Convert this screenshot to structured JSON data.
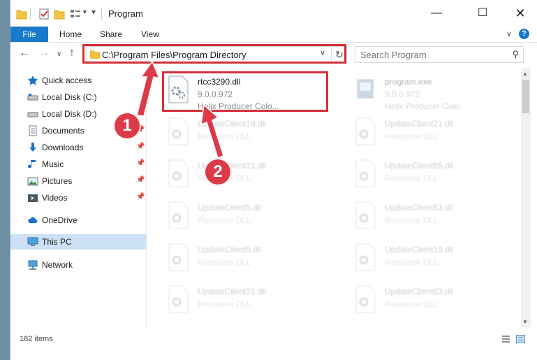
{
  "window": {
    "title": "Program"
  },
  "ribbon": {
    "file": "File",
    "home": "Home",
    "share": "Share",
    "view": "View",
    "help": "?"
  },
  "nav": {
    "address": "C:\\Program Files\\Program Directory",
    "search_placeholder": "Search Program"
  },
  "sidebar": {
    "items": [
      {
        "label": "Quick access",
        "icon": "star-icon"
      },
      {
        "label": "Local Disk (C:)",
        "icon": "drive-icon"
      },
      {
        "label": "Local Disk (D:)",
        "icon": "drive-icon"
      },
      {
        "label": "Documents",
        "icon": "documents-icon"
      },
      {
        "label": "Downloads",
        "icon": "download-icon"
      },
      {
        "label": "Music",
        "icon": "music-icon"
      },
      {
        "label": "Pictures",
        "icon": "pictures-icon"
      },
      {
        "label": "Videos",
        "icon": "videos-icon"
      },
      {
        "label": "OneDrive",
        "icon": "cloud-icon"
      },
      {
        "label": "This PC",
        "icon": "computer-icon"
      },
      {
        "label": "Network",
        "icon": "network-icon"
      }
    ]
  },
  "files": [
    {
      "name": "rtcc3290.dll",
      "line1": "9.0.0.972",
      "line2": "Helix Producer Colo..."
    },
    {
      "name": "program.exe",
      "line1": "9.0.0.972",
      "line2": "Helix Producer Colo..."
    },
    {
      "name": "UpdateClient19.dll",
      "line1": "Resource DLL"
    },
    {
      "name": "UpdateClient21.dll",
      "line1": "Resource DLL"
    },
    {
      "name": "UpdateClient21.dll",
      "line1": "Resource DLL"
    },
    {
      "name": "UpdateClient65.dll",
      "line1": "Resource DLL"
    },
    {
      "name": "UpdateClient5.dll",
      "line1": "Resource DLL"
    },
    {
      "name": "UpdateClient63.dll",
      "line1": "Resource DLL"
    },
    {
      "name": "UpdateClient5.dll",
      "line1": "Resource DLL"
    },
    {
      "name": "UpdateClient19.dll",
      "line1": "Resource DLL"
    },
    {
      "name": "UpdateClient21.dll",
      "line1": "Resource DLL"
    },
    {
      "name": "UpdateClient63.dll",
      "line1": "Resource DLL"
    }
  ],
  "status": {
    "item_count": "182 items"
  },
  "annotations": {
    "step1": "1",
    "step2": "2",
    "color": "#d4303a"
  }
}
